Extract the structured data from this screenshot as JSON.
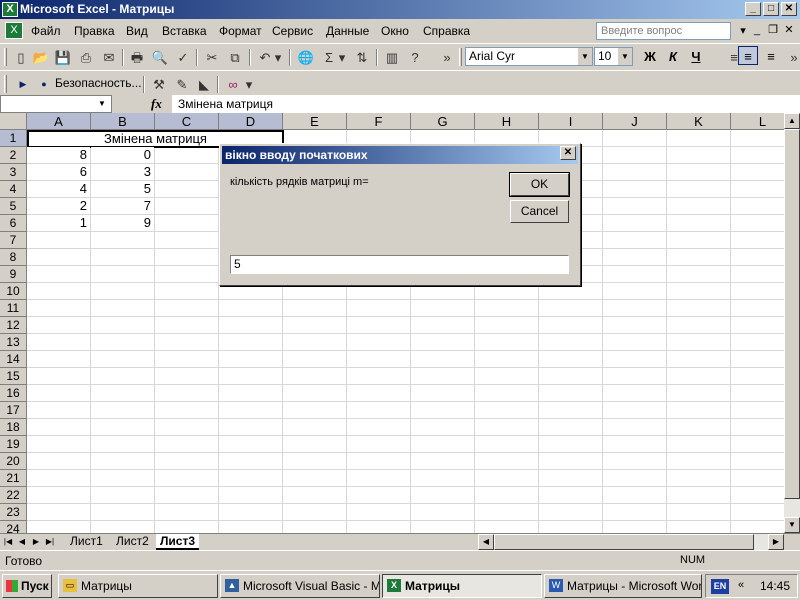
{
  "window": {
    "title": "Microsoft Excel - Матрицы",
    "min": "_",
    "max": "□",
    "close": "✕"
  },
  "menu": {
    "items": [
      "Файл",
      "Правка",
      "Вид",
      "Вставка",
      "Формат",
      "Сервис",
      "Данные",
      "Окно",
      "Справка"
    ],
    "help_placeholder": "Введите вопрос"
  },
  "toolbar": {
    "font": "Arial Cyr",
    "size": "10",
    "bold": "Ж",
    "italic": "К",
    "underline": "Ч",
    "security": "Безопасность..."
  },
  "formula_bar": {
    "name_box": "",
    "fx": "fx",
    "content": "Змінена матриця"
  },
  "grid": {
    "columns": [
      "A",
      "B",
      "C",
      "D",
      "E",
      "F",
      "G",
      "H",
      "I",
      "J",
      "K",
      "L"
    ],
    "rows": [
      "1",
      "2",
      "3",
      "4",
      "5",
      "6",
      "7",
      "8",
      "9",
      "10",
      "11",
      "12",
      "13",
      "14",
      "15",
      "16",
      "17",
      "18",
      "19",
      "20",
      "21",
      "22",
      "23",
      "24"
    ],
    "merged_title": "Змінена матриця",
    "col_a": [
      "8",
      "6",
      "4",
      "2",
      "1"
    ],
    "col_b": [
      "0",
      "3",
      "5",
      "7",
      "9"
    ]
  },
  "sheets": {
    "tabs": [
      "Лист1",
      "Лист2",
      "Лист3"
    ],
    "active": "Лист3"
  },
  "status": {
    "text": "Готово",
    "num": "NUM"
  },
  "dialog": {
    "title": "вікно вводу початкових",
    "prompt": "кількість рядків матриці m=",
    "ok": "OK",
    "cancel": "Cancel",
    "input_value": "5"
  },
  "taskbar": {
    "start": "Пуск",
    "items": [
      "Матрицы",
      "Microsoft Visual Basic - М...",
      "Матрицы",
      "Матрицы - Microsoft Word"
    ],
    "lang": "EN",
    "clock": "14:45"
  }
}
